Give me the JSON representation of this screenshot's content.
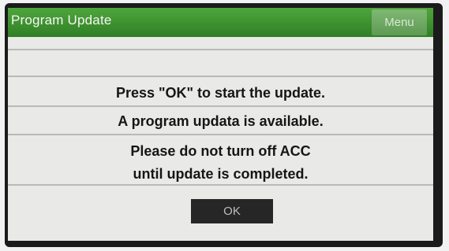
{
  "header": {
    "title": "Program Update",
    "menu_label": "Menu"
  },
  "dialog": {
    "line1": "Press \"OK\" to start the update.",
    "line2": "A program updata is available.",
    "line3": "Please do not turn off ACC",
    "line4": "until update is completed.",
    "ok_label": "OK"
  },
  "colors": {
    "header_green": "#3e9331",
    "screen_bg": "#e9e9e7",
    "ok_button_bg": "#262626"
  }
}
